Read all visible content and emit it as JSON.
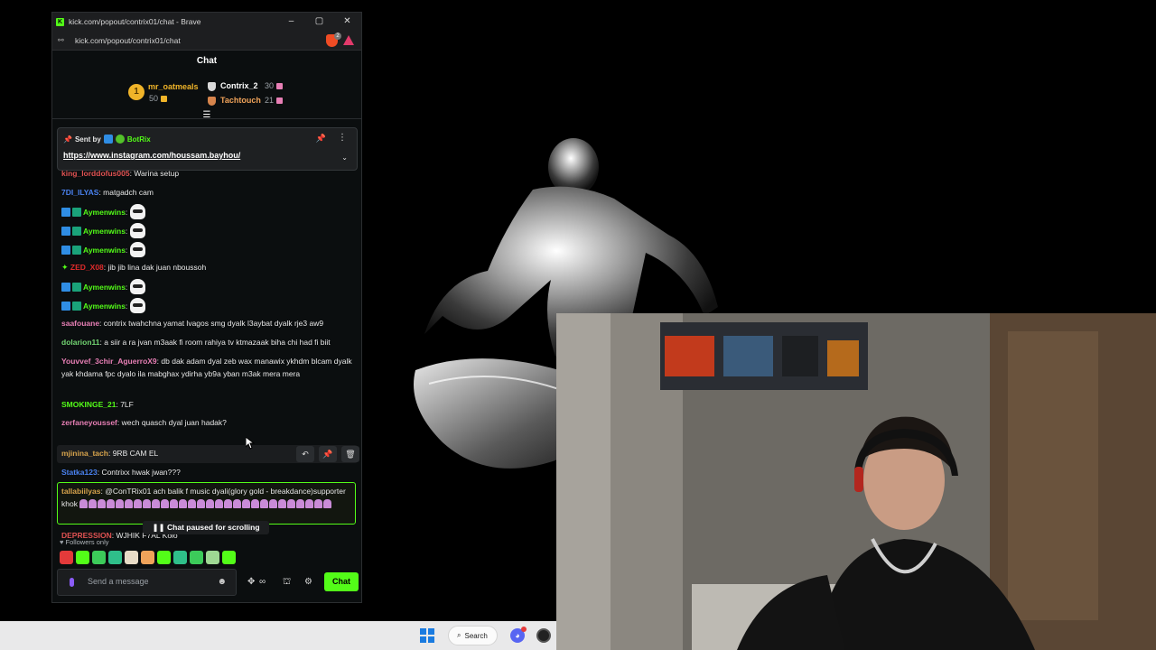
{
  "browser": {
    "title": "kick.com/popout/contrix01/chat - Brave",
    "url": "kick.com/popout/contrix01/chat",
    "brave_badge": "2"
  },
  "chat": {
    "header": "Chat",
    "leaderboard": {
      "rank1_badge": "1",
      "rank1_name": "mr_oatmeals",
      "rank1_count": "50",
      "rank2_name": "Contrix_2",
      "rank2_count": "30",
      "rank3_name": "Tachtouch",
      "rank3_count": "21"
    },
    "pinned": {
      "sent_by_label": "Sent by",
      "sender": "BotRix",
      "link": "https://www.instagram.com/houssam.bayhou/"
    },
    "messages": [
      {
        "user": "king_lorddofus005",
        "color": "#e05252",
        "text": "Warina setup"
      },
      {
        "user": "7DI_ILYAS",
        "color": "#4a82f0",
        "text": "matgadch cam"
      },
      {
        "user": "Aymenwins",
        "color": "#53fc18",
        "text": ""
      },
      {
        "user": "Aymenwins",
        "color": "#53fc18",
        "text": ""
      },
      {
        "user": "Aymenwins",
        "color": "#53fc18",
        "text": ""
      },
      {
        "user": "ZED_X08",
        "color": "#e02b2b",
        "text": "jib jib lina dak juan nboussoh"
      },
      {
        "user": "Aymenwins",
        "color": "#53fc18",
        "text": ""
      },
      {
        "user": "Aymenwins",
        "color": "#53fc18",
        "text": ""
      },
      {
        "user": "saafouane",
        "color": "#e77fb5",
        "text": "contrix twahchna yamat lvagos smg dyalk l3aybat dyalk rje3 aw9"
      },
      {
        "user": "dolarion11",
        "color": "#72d572",
        "text": "a siir a ra jvan m3aak fi room rahiya tv ktmazaak biha chi had fi biit"
      },
      {
        "user": "Youvvef_3chir_AguerroX9",
        "color": "#e77fb5",
        "text": "db dak adam dyal zeb wax manawix ykhdm blcam dyalk yak khdama fpc dyalo ila mabghax ydirha yb9a yban m3ak mera mera"
      },
      {
        "user": "SMOKINGE_21",
        "color": "#53fc18",
        "text": "7LF"
      },
      {
        "user": "zerfaneyoussef",
        "color": "#e77fb5",
        "text": "wech quasch dyal juan hadak?"
      },
      {
        "user": "mjinina_tach",
        "color": "#d6a34c",
        "text": "9RB CAM EL"
      },
      {
        "user": "Statka123",
        "color": "#4a82f0",
        "text": "Contrixx hwak jwan???"
      },
      {
        "user": "tallabiilyas",
        "color": "#d6a34c",
        "text": "@ConTRix01 ach balik f music dyali(glory gold - breakdance)supporter khok"
      },
      {
        "user": "DEPRESSION",
        "color": "#e05252",
        "text": "WJHIK F7AL Kolo"
      }
    ],
    "paused_label": "Chat paused for scrolling",
    "followers_only": "Followers only",
    "input_placeholder": "Send a message",
    "send_button": "Chat"
  },
  "taskbar": {
    "search_label": "Search"
  },
  "colors": {
    "kick_green": "#53fc18",
    "gold": "#f0b429"
  }
}
